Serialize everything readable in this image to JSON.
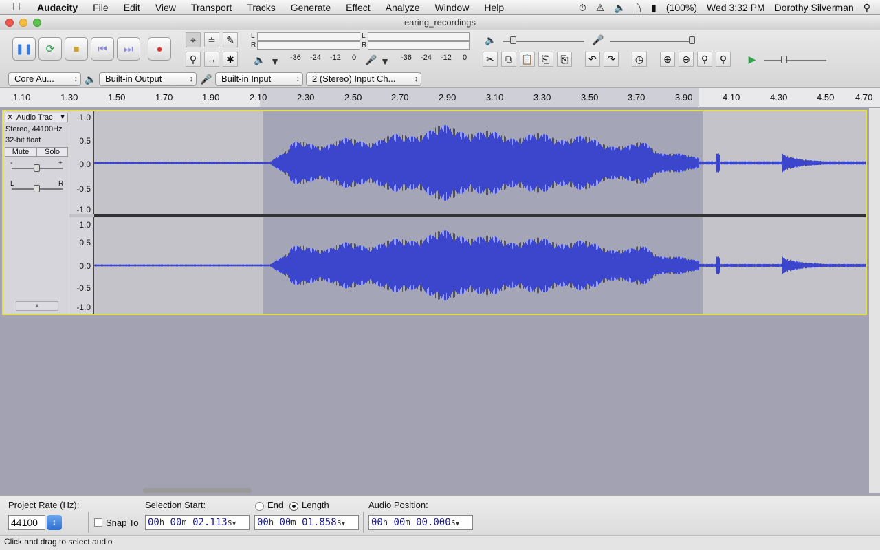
{
  "menubar": {
    "app_name": "Audacity",
    "items": [
      "File",
      "Edit",
      "View",
      "Transport",
      "Tracks",
      "Generate",
      "Effect",
      "Analyze",
      "Window",
      "Help"
    ],
    "battery": "(100%)",
    "clock": "Wed 3:32 PM",
    "user": "Dorothy Silverman"
  },
  "window": {
    "title": "earing_recordings"
  },
  "meters": {
    "play_L": "L",
    "play_R": "R",
    "rec_L": "L",
    "rec_R": "R",
    "play_scale": [
      "-36",
      "-24",
      "-12",
      "0"
    ],
    "rec_scale": [
      "-36",
      "-24",
      "-12",
      "0"
    ]
  },
  "devices": {
    "host": "Core Au...",
    "output": "Built-in Output",
    "input": "Built-in Input",
    "channels": "2 (Stereo) Input Ch..."
  },
  "ruler": {
    "ticks": [
      "1.10",
      "1.30",
      "1.50",
      "1.70",
      "1.90",
      "2.10",
      "2.30",
      "2.50",
      "2.70",
      "2.90",
      "3.10",
      "3.30",
      "3.50",
      "3.70",
      "3.90",
      "4.10",
      "4.30",
      "4.50",
      "4.70"
    ]
  },
  "track": {
    "name": "Audio Trac",
    "format": "Stereo, 44100Hz",
    "bitdepth": "32-bit float",
    "mute": "Mute",
    "solo": "Solo",
    "gain_minus": "-",
    "gain_plus": "+",
    "pan_left": "L",
    "pan_right": "R",
    "scale": [
      "1.0",
      "0.5",
      "0.0",
      "-0.5",
      "-1.0"
    ]
  },
  "selection_bar": {
    "project_rate_label": "Project Rate (Hz):",
    "project_rate": "44100",
    "snap_to": "Snap To",
    "selection_start_label": "Selection Start:",
    "end_label": "End",
    "length_label": "Length",
    "audio_position_label": "Audio Position:",
    "selection_start": {
      "h": "00",
      "m": "00",
      "s": "02.113"
    },
    "length": {
      "h": "00",
      "m": "00",
      "s": "01.858"
    },
    "audio_position": {
      "h": "00",
      "m": "00",
      "s": "00.000"
    },
    "unit_h": "h",
    "unit_m": "m",
    "unit_s": "s"
  },
  "status": "Click and drag to select audio",
  "colors": {
    "waveform": "#3b46cc",
    "selection": "#a5a5b8",
    "track_bg": "#c3c3c9",
    "focus": "#e5e04a"
  }
}
